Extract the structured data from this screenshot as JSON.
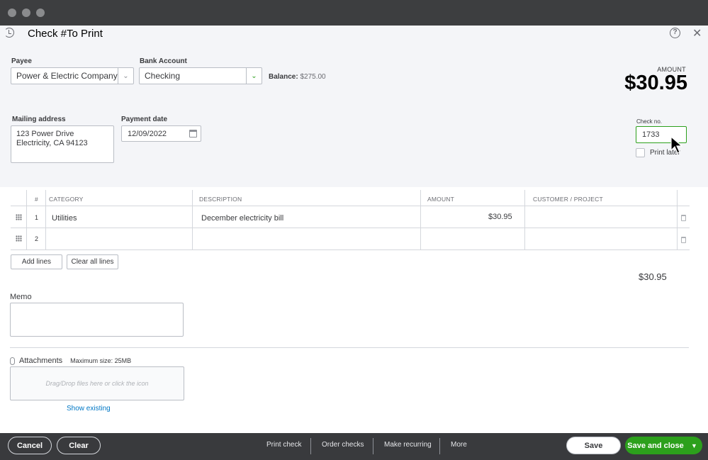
{
  "header": {
    "title": "Check #To Print"
  },
  "payee": {
    "label": "Payee",
    "value": "Power & Electric Company"
  },
  "bank_account": {
    "label": "Bank Account",
    "value": "Checking",
    "balance_label": "Balance:",
    "balance_value": "$275.00"
  },
  "amount": {
    "label": "AMOUNT",
    "value": "$30.95"
  },
  "mailing": {
    "label": "Mailing address",
    "line1": "123 Power Drive",
    "line2": "Electricity, CA 94123"
  },
  "payment_date": {
    "label": "Payment date",
    "value": "12/09/2022"
  },
  "check_no": {
    "label": "Check no.",
    "value": "1733",
    "print_later": "Print later"
  },
  "table": {
    "headers": [
      "#",
      "CATEGORY",
      "DESCRIPTION",
      "AMOUNT",
      "CUSTOMER / PROJECT"
    ],
    "rows": [
      {
        "num": "1",
        "category": "Utilities",
        "description": "December electricity bill",
        "amount": "$30.95",
        "customer": ""
      },
      {
        "num": "2",
        "category": "",
        "description": "",
        "amount": "",
        "customer": ""
      }
    ],
    "add_lines": "Add lines",
    "clear_all_lines": "Clear all lines",
    "total": "$30.95"
  },
  "memo": {
    "label": "Memo"
  },
  "attachments": {
    "label": "Attachments",
    "max_size": "Maximum size: 25MB",
    "drop_text": "Drag/Drop files here or click the icon",
    "show_existing": "Show existing"
  },
  "footer": {
    "cancel": "Cancel",
    "clear": "Clear",
    "print_check": "Print check",
    "order_checks": "Order checks",
    "make_recurring": "Make recurring",
    "more": "More",
    "save": "Save",
    "save_and_close": "Save and close"
  },
  "colors": {
    "accent_green": "#2ca01c",
    "link_blue": "#0077c5",
    "footer_bg": "#393a3d"
  }
}
